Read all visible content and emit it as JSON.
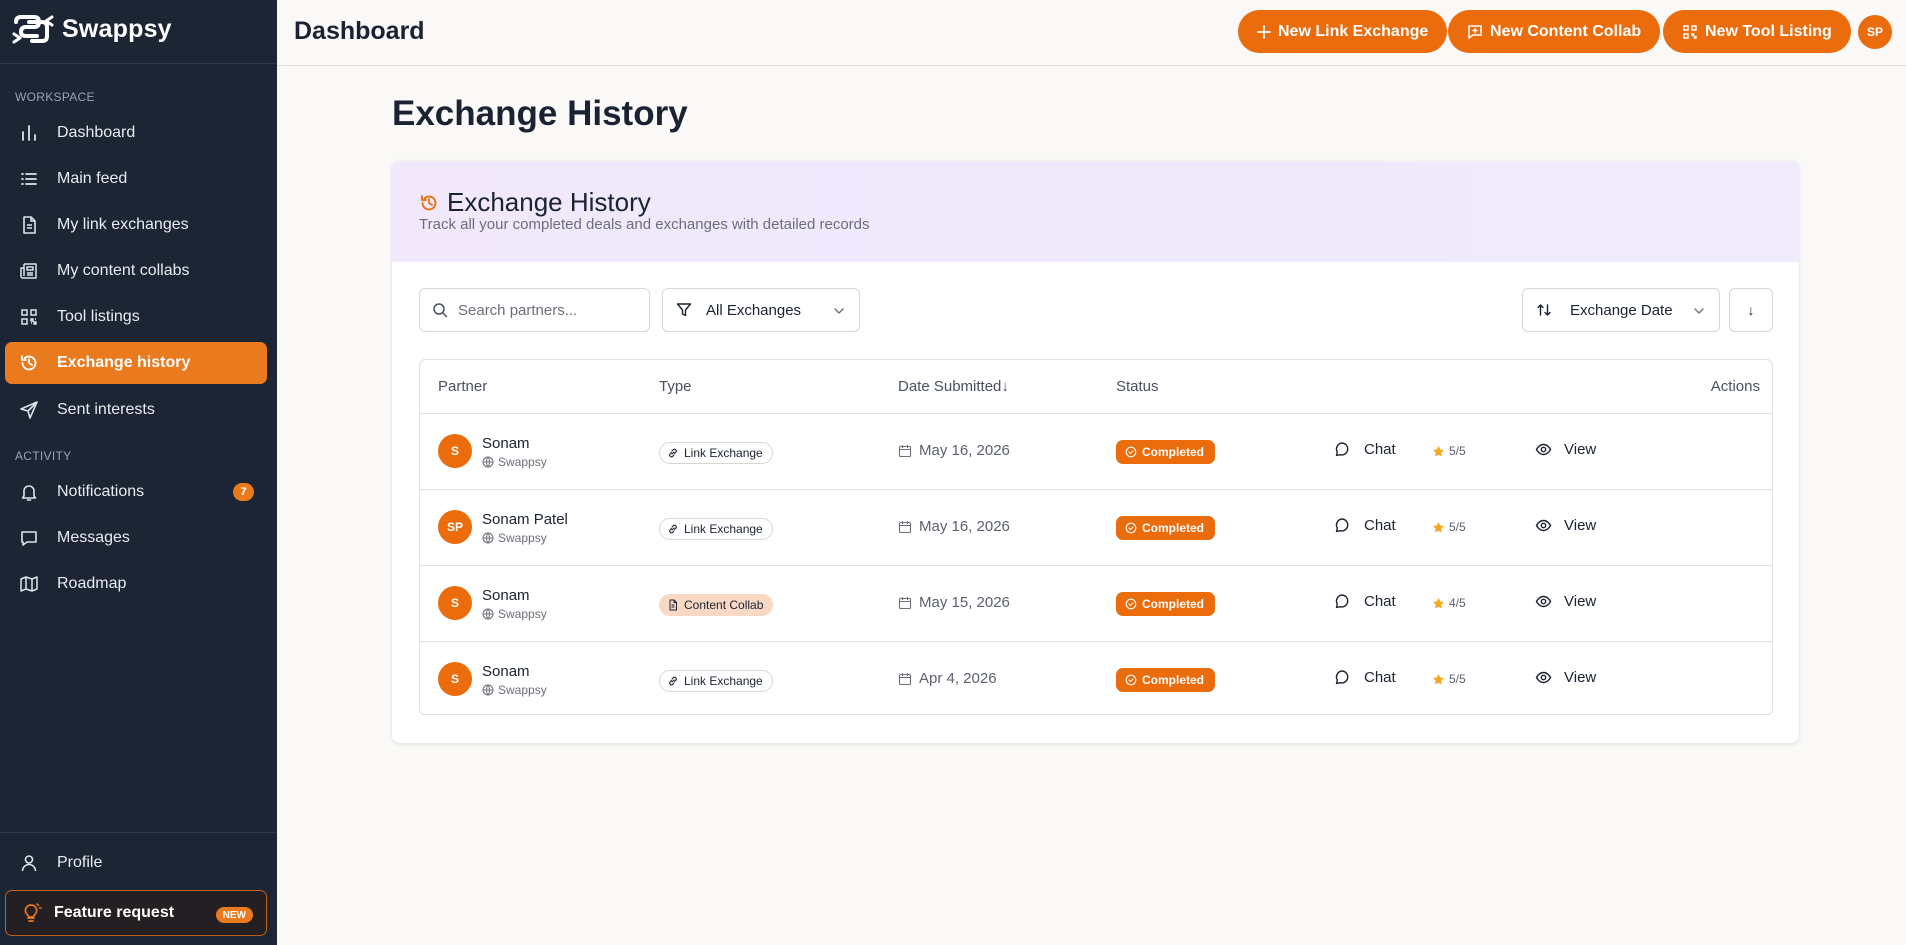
{
  "brand": {
    "name": "Swappsy",
    "logo_icon": "swappsy-logo-icon"
  },
  "sidebar": {
    "workspace_label": "WORKSPACE",
    "activity_label": "ACTIVITY",
    "workspace_items": [
      {
        "label": "Dashboard",
        "icon": "bar-chart-icon"
      },
      {
        "label": "Main feed",
        "icon": "list-icon"
      },
      {
        "label": "My link exchanges",
        "icon": "document-icon"
      },
      {
        "label": "My content collabs",
        "icon": "newspaper-icon"
      },
      {
        "label": "Tool listings",
        "icon": "qr-grid-icon"
      },
      {
        "label": "Exchange history",
        "icon": "history-icon",
        "active": true
      },
      {
        "label": "Sent interests",
        "icon": "send-icon"
      }
    ],
    "activity_items": [
      {
        "label": "Notifications",
        "icon": "bell-icon",
        "badge": "7"
      },
      {
        "label": "Messages",
        "icon": "message-icon"
      },
      {
        "label": "Roadmap",
        "icon": "map-icon"
      }
    ],
    "profile_label": "Profile",
    "feature_request": {
      "label": "Feature request",
      "badge": "NEW"
    }
  },
  "topbar": {
    "title": "Dashboard",
    "buttons": {
      "link_exchange": "New Link Exchange",
      "content_collab": "New Content Collab",
      "tool_listing": "New Tool Listing"
    },
    "avatar_initials": "SP"
  },
  "page": {
    "title": "Exchange History",
    "card_title": "Exchange History",
    "card_subtitle": "Track all your completed deals and exchanges with detailed records"
  },
  "filters": {
    "search_placeholder": "Search partners...",
    "type_filter": "All Exchanges",
    "sort_by": "Exchange Date",
    "sort_direction": "↓"
  },
  "table": {
    "headers": {
      "partner": "Partner",
      "type": "Type",
      "date": "Date Submitted↓",
      "status": "Status",
      "actions": "Actions"
    },
    "chat_label": "Chat",
    "view_label": "View",
    "rows": [
      {
        "initials": "S",
        "name": "Sonam",
        "site": "Swappsy",
        "type": "Link Exchange",
        "type_kind": "link",
        "date": "May 16, 2026",
        "status": "Completed",
        "rating": "5/5"
      },
      {
        "initials": "SP",
        "name": "Sonam Patel",
        "site": "Swappsy",
        "type": "Link Exchange",
        "type_kind": "link",
        "date": "May 16, 2026",
        "status": "Completed",
        "rating": "5/5"
      },
      {
        "initials": "S",
        "name": "Sonam",
        "site": "Swappsy",
        "type": "Content Collab",
        "type_kind": "content",
        "date": "May 15, 2026",
        "status": "Completed",
        "rating": "4/5"
      },
      {
        "initials": "S",
        "name": "Sonam",
        "site": "Swappsy",
        "type": "Link Exchange",
        "type_kind": "link",
        "date": "Apr 4, 2026",
        "status": "Completed",
        "rating": "5/5"
      }
    ]
  },
  "colors": {
    "accent": "#ea6c0c",
    "sidebar_bg": "#1c2534",
    "star": "#f5a623"
  }
}
